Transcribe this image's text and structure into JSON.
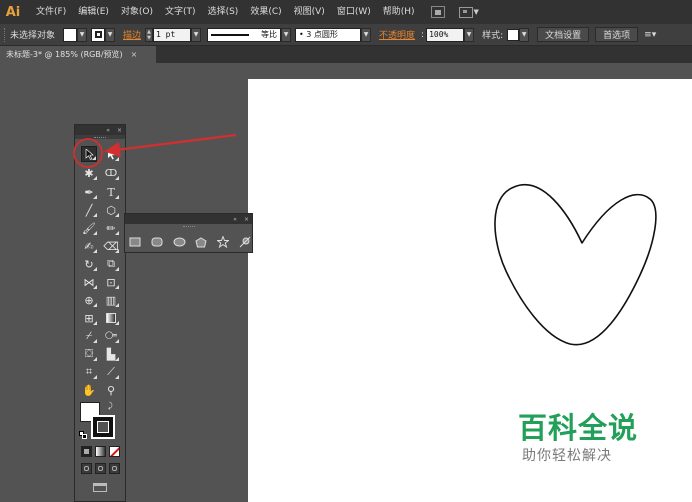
{
  "app": {
    "logo": "Ai"
  },
  "menu": {
    "items": [
      "文件(F)",
      "编辑(E)",
      "对象(O)",
      "文字(T)",
      "选择(S)",
      "效果(C)",
      "视图(V)",
      "窗口(W)",
      "帮助(H)"
    ]
  },
  "control_bar": {
    "selection_status": "未选择对象",
    "stroke_link": "描边",
    "stroke_weight": "1 pt",
    "stroke_profile": "等比",
    "brush": "• 3 点圆形",
    "opacity_link": "不透明度",
    "opacity_value": "100%",
    "style_label": "样式:",
    "doc_setup_button": "文档设置",
    "preferences_button": "首选项"
  },
  "document_tab": {
    "title": "未标题-3* @ 185% (RGB/预览)",
    "close": "×"
  },
  "tools_panel": {
    "collapse": "«",
    "close": "×"
  },
  "shape_flyout": {
    "collapse": "«",
    "close": "×"
  },
  "colors": {
    "accent_orange": "#e7852d",
    "annotation_red": "#d32f2f",
    "watermark_green": "#22a05a"
  },
  "watermark": {
    "title": "百科全说",
    "subtitle": "助你轻松解决"
  }
}
